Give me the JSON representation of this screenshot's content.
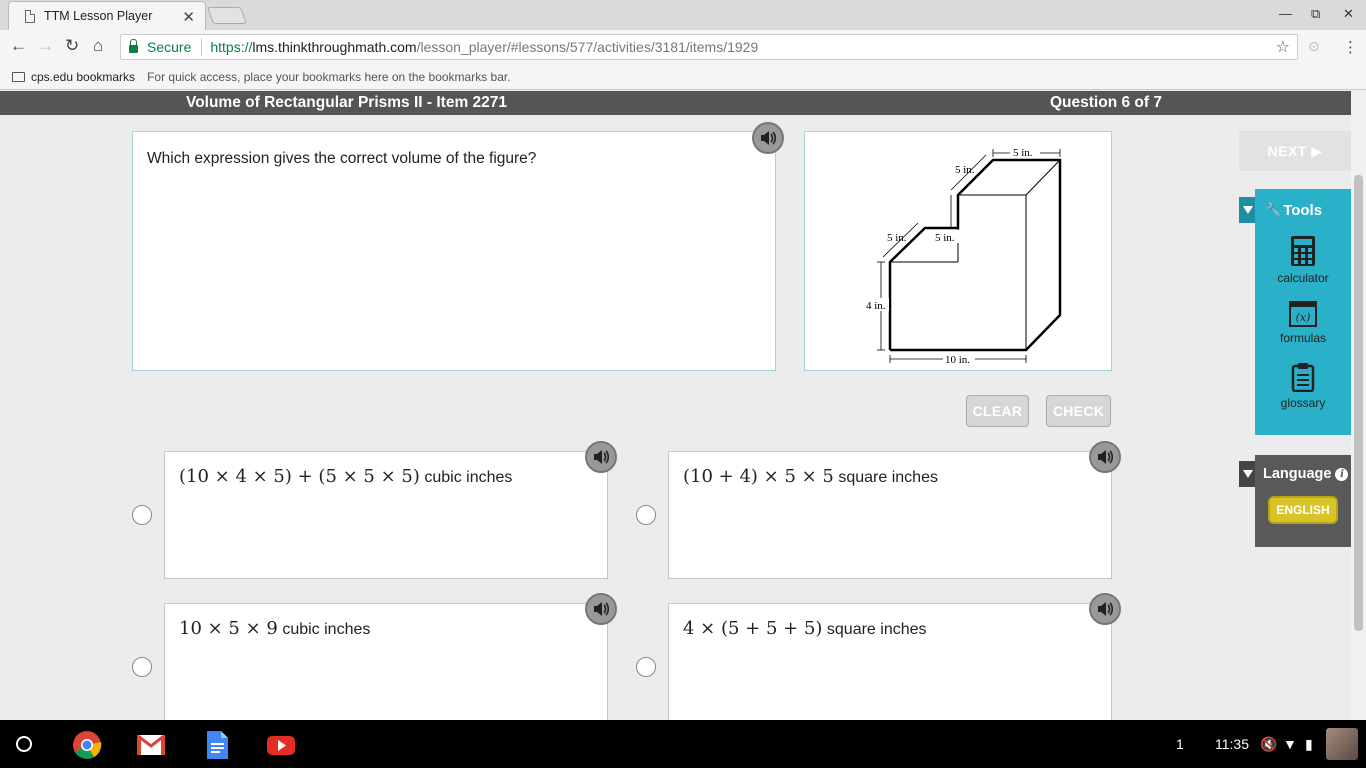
{
  "browser": {
    "tab_title": "TTM Lesson Player",
    "tab_close": "✕",
    "secure_label": "Secure",
    "url_scheme": "https://",
    "url_host": "lms.thinkthroughmath.com",
    "url_path": "/lesson_player/#lessons/577/activities/3181/items/1929",
    "bookmarks_folder": "cps.edu bookmarks",
    "bookmarks_hint": "For quick access, place your bookmarks here on the bookmarks bar."
  },
  "lesson": {
    "title": "Volume of Rectangular Prisms II - Item 2271",
    "question_counter": "Question 6 of 7",
    "question_text": "Which expression gives the correct volume of the figure?"
  },
  "figure": {
    "labels": {
      "top_width": "5 in.",
      "top_depth": "5 in.",
      "step_depth": "5 in.",
      "step_height": "5 in.",
      "left_height": "4 in.",
      "bottom_width": "10 in."
    }
  },
  "actions": {
    "clear": "CLEAR",
    "check": "CHECK",
    "next": "NEXT ▶"
  },
  "answers": [
    {
      "math": "(10 × 4 × 5) + (5 × 5 × 5)",
      "unit": "cubic inches"
    },
    {
      "math": "(10 + 4) × 5 × 5",
      "unit": "square inches"
    },
    {
      "math": "10 × 5 × 9",
      "unit": "cubic inches"
    },
    {
      "math": "4 × (5 + 5 + 5)",
      "unit": "square inches"
    }
  ],
  "tools": {
    "header": "Tools",
    "items": [
      {
        "label": "calculator",
        "icon": "calculator-icon"
      },
      {
        "label": "formulas",
        "icon": "formulas-icon"
      },
      {
        "label": "glossary",
        "icon": "glossary-icon"
      }
    ],
    "formulas_glyph": "(x)"
  },
  "language": {
    "header": "Language",
    "info_glyph": "i",
    "selected": "ENGLISH"
  },
  "shelf": {
    "notification_count": "1",
    "time": "11:35"
  },
  "colors": {
    "teal_tools": "#2ab0c8",
    "header_bar": "#555555",
    "english_yellow": "#d8c428",
    "secure_green": "#0b8043"
  }
}
